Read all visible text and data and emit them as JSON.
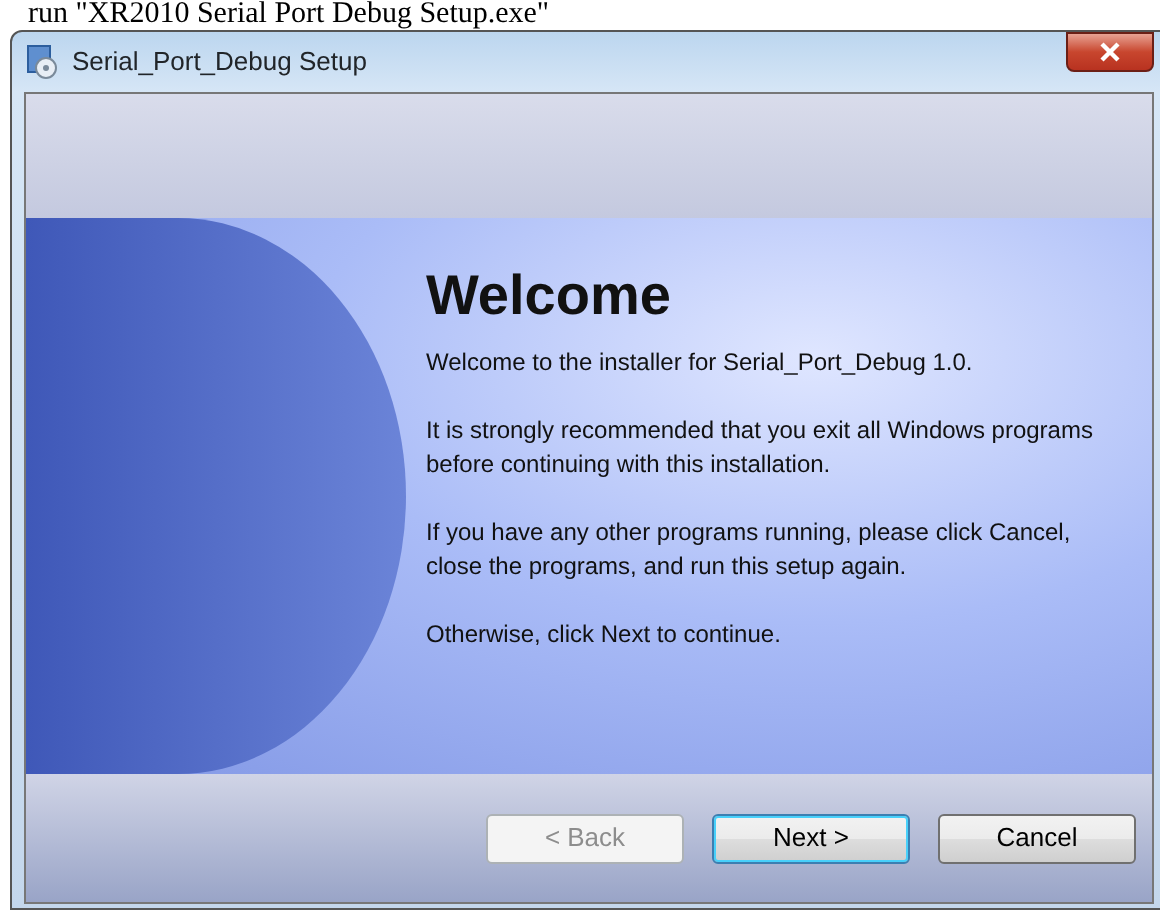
{
  "background_text": "run \"XR2010 Serial Port Debug Setup.exe\"",
  "window": {
    "title": "Serial_Port_Debug Setup"
  },
  "heading": "Welcome",
  "paragraphs": [
    "Welcome to the installer for Serial_Port_Debug 1.0.",
    "It is strongly recommended that you exit all Windows programs before continuing with this installation.",
    "If you have any other programs running, please click Cancel, close the programs, and run this setup again.",
    "Otherwise, click Next to continue."
  ],
  "buttons": [
    {
      "label": "< Back",
      "disabled": true,
      "default": false
    },
    {
      "label": "Next >",
      "disabled": false,
      "default": true
    },
    {
      "label": "Cancel",
      "disabled": false,
      "default": false
    }
  ]
}
